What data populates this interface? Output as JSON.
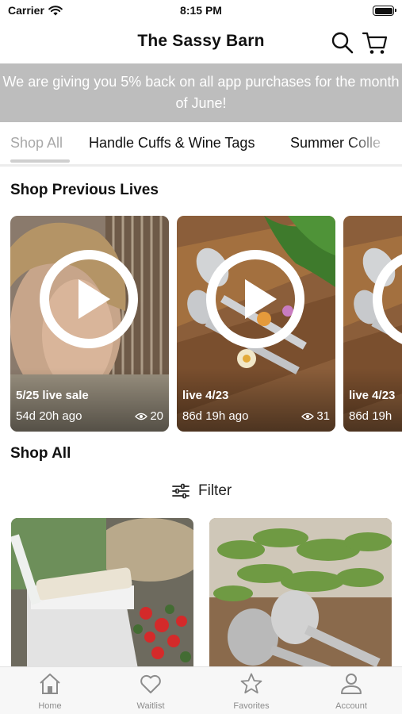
{
  "status_bar": {
    "carrier": "Carrier",
    "time": "8:15 PM"
  },
  "nav": {
    "title": "The Sassy Barn"
  },
  "promo": {
    "text": "We are giving you 5% back on all app purchases for the month of June!"
  },
  "tabs": [
    {
      "label": "Shop All",
      "selected": true
    },
    {
      "label": "Handle Cuffs & Wine Tags",
      "selected": false
    },
    {
      "label": "Summer Colle",
      "selected": false
    }
  ],
  "sections": {
    "lives_heading": "Shop Previous Lives",
    "shop_all_heading": "Shop All"
  },
  "lives": [
    {
      "title": "5/25 live sale",
      "age": "54d 20h ago",
      "views": "20"
    },
    {
      "title": "live 4/23",
      "age": "86d 19h ago",
      "views": "31"
    },
    {
      "title": "live 4/23",
      "age": "86d 19h",
      "views": ""
    }
  ],
  "filter": {
    "label": "Filter"
  },
  "tabbar": [
    {
      "label": "Home",
      "icon": "home-icon"
    },
    {
      "label": "Waitlist",
      "icon": "heart-icon"
    },
    {
      "label": "Favorites",
      "icon": "star-icon"
    },
    {
      "label": "Account",
      "icon": "person-icon"
    }
  ],
  "colors": {
    "banner_bg": "#bdbdbd",
    "tab_inactive": "#a8a8a8",
    "tabbar_label": "#8c8c8c"
  }
}
